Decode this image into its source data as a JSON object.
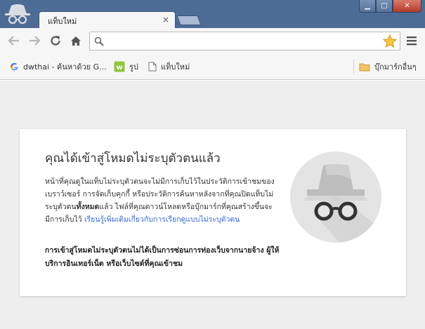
{
  "tab": {
    "title": "แท็บใหม่",
    "close_glyph": "×"
  },
  "window": {
    "min_glyph": "▁",
    "max_glyph": "□",
    "close_glyph": "✕"
  },
  "omnibox": {
    "value": "",
    "placeholder": ""
  },
  "bookmarks": {
    "items": [
      {
        "label": "dwthai - ค้นหาด้วย G...",
        "icon": "google-icon"
      },
      {
        "label": "รูป",
        "icon": "web-icon"
      },
      {
        "label": "แท็บใหม่",
        "icon": "page-icon"
      }
    ],
    "other": {
      "label": "บุ๊กมาร์กอื่นๆ",
      "icon": "folder-icon"
    }
  },
  "incognito": {
    "title": "คุณได้เข้าสู่โหมดไม่ระบุตัวตนแล้ว",
    "desc_part1": "หน้าที่คุณดูในแท็บไม่ระบุตัวตนจะไม่มีการเก็บไว้ในประวัติการเข้าชมของเบราว์เซอร์ การจัดเก็บคุกกี้ หรือประวัติการค้นหาหลังจากที่คุณปิดแท็บไม่ระบุตัวตน",
    "desc_bold": "ทั้งหมด",
    "desc_part2": "แล้ว ไฟล์ที่คุณดาวน์โหลดหรือบุ๊กมาร์กที่คุณสร้างขึ้นจะมีการเก็บไว้ ",
    "learn_more": "เรียนรู้เพิ่มเติมเกี่ยวกับการเรียกดูแบบไม่ระบุตัวตน",
    "warning": "การเข้าสู่โหมดไม่ระบุตัวตนไม่ได้เป็นการซ่อนการท่องเว็บจากนายจ้าง ผู้ให้บริการอินเทอร์เน็ต หรือเว็บไซต์ที่คุณเข้าชม"
  },
  "colors": {
    "frame": "#4d6c95",
    "link": "#3367d6",
    "content_bg": "#eeeeee",
    "icon_circle": "#e4e4e4"
  }
}
